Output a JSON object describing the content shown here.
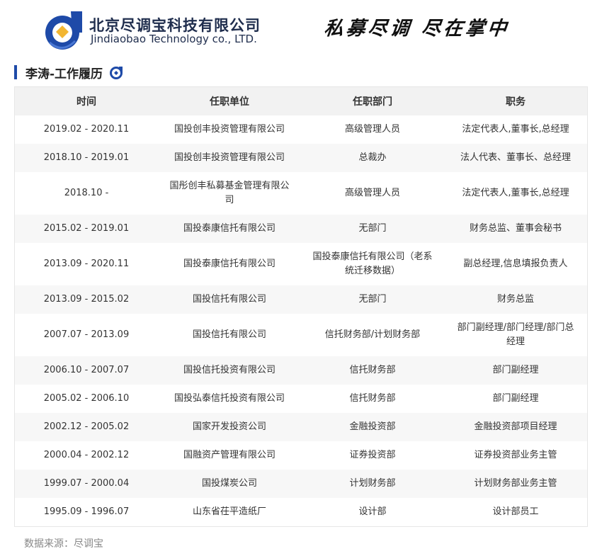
{
  "header": {
    "company_cn": "北京尽调宝科技有限公司",
    "company_en": "Jindiaobao Technology co., LTD.",
    "slogan": "私募尽调  尽在掌中",
    "brand_color": "#1e4aa8",
    "accent_color": "#f2b632",
    "logo_icon": "jindiaobao-logo-icon"
  },
  "section": {
    "title": "李涛-工作履历",
    "icon": "jindiaobao-d-icon"
  },
  "table": {
    "columns": [
      "时间",
      "任职单位",
      "任职部门",
      "职务"
    ],
    "rows": [
      {
        "period": "2019.02 - 2020.11",
        "company": "国投创丰投资管理有限公司",
        "dept": "高级管理人员",
        "title": "法定代表人,董事长,总经理",
        "tall": false
      },
      {
        "period": "2018.10 - 2019.01",
        "company": "国投创丰投资管理有限公司",
        "dept": "总裁办",
        "title": "法人代表、董事长、总经理",
        "tall": false
      },
      {
        "period": "2018.10 -",
        "company": "国彤创丰私募基金管理有限公司",
        "dept": "高级管理人员",
        "title": "法定代表人,董事长,总经理",
        "tall": true
      },
      {
        "period": "2015.02 - 2019.01",
        "company": "国投泰康信托有限公司",
        "dept": "无部门",
        "title": "财务总监、董事会秘书",
        "tall": false
      },
      {
        "period": "2013.09 - 2020.11",
        "company": "国投泰康信托有限公司",
        "dept": "国投泰康信托有限公司（老系统迁移数据）",
        "title": "副总经理,信息填报负责人",
        "tall": true
      },
      {
        "period": "2013.09 - 2015.02",
        "company": "国投信托有限公司",
        "dept": "无部门",
        "title": "财务总监",
        "tall": false
      },
      {
        "period": "2007.07 - 2013.09",
        "company": "国投信托有限公司",
        "dept": "信托财务部/计划财务部",
        "title": "部门副经理/部门经理/部门总经理",
        "tall": true
      },
      {
        "period": "2006.10 - 2007.07",
        "company": "国投信托投资有限公司",
        "dept": "信托财务部",
        "title": "部门副经理",
        "tall": false
      },
      {
        "period": "2005.02 - 2006.10",
        "company": "国投弘泰信托投资有限公司",
        "dept": "信托财务部",
        "title": "部门副经理",
        "tall": false
      },
      {
        "period": "2002.12 - 2005.02",
        "company": "国家开发投资公司",
        "dept": "金融投资部",
        "title": "金融投资部项目经理",
        "tall": false
      },
      {
        "period": "2000.04 - 2002.12",
        "company": "国融资产管理有限公司",
        "dept": "证券投资部",
        "title": "证券投资部业务主管",
        "tall": false
      },
      {
        "period": "1999.07 - 2000.04",
        "company": "国投煤炭公司",
        "dept": "计划财务部",
        "title": "计划财务部业务主管",
        "tall": false
      },
      {
        "period": "1995.09 - 1996.07",
        "company": "山东省茌平造纸厂",
        "dept": "设计部",
        "title": "设计部员工",
        "tall": false
      }
    ]
  },
  "footer": {
    "source": "数据来源：尽调宝"
  }
}
